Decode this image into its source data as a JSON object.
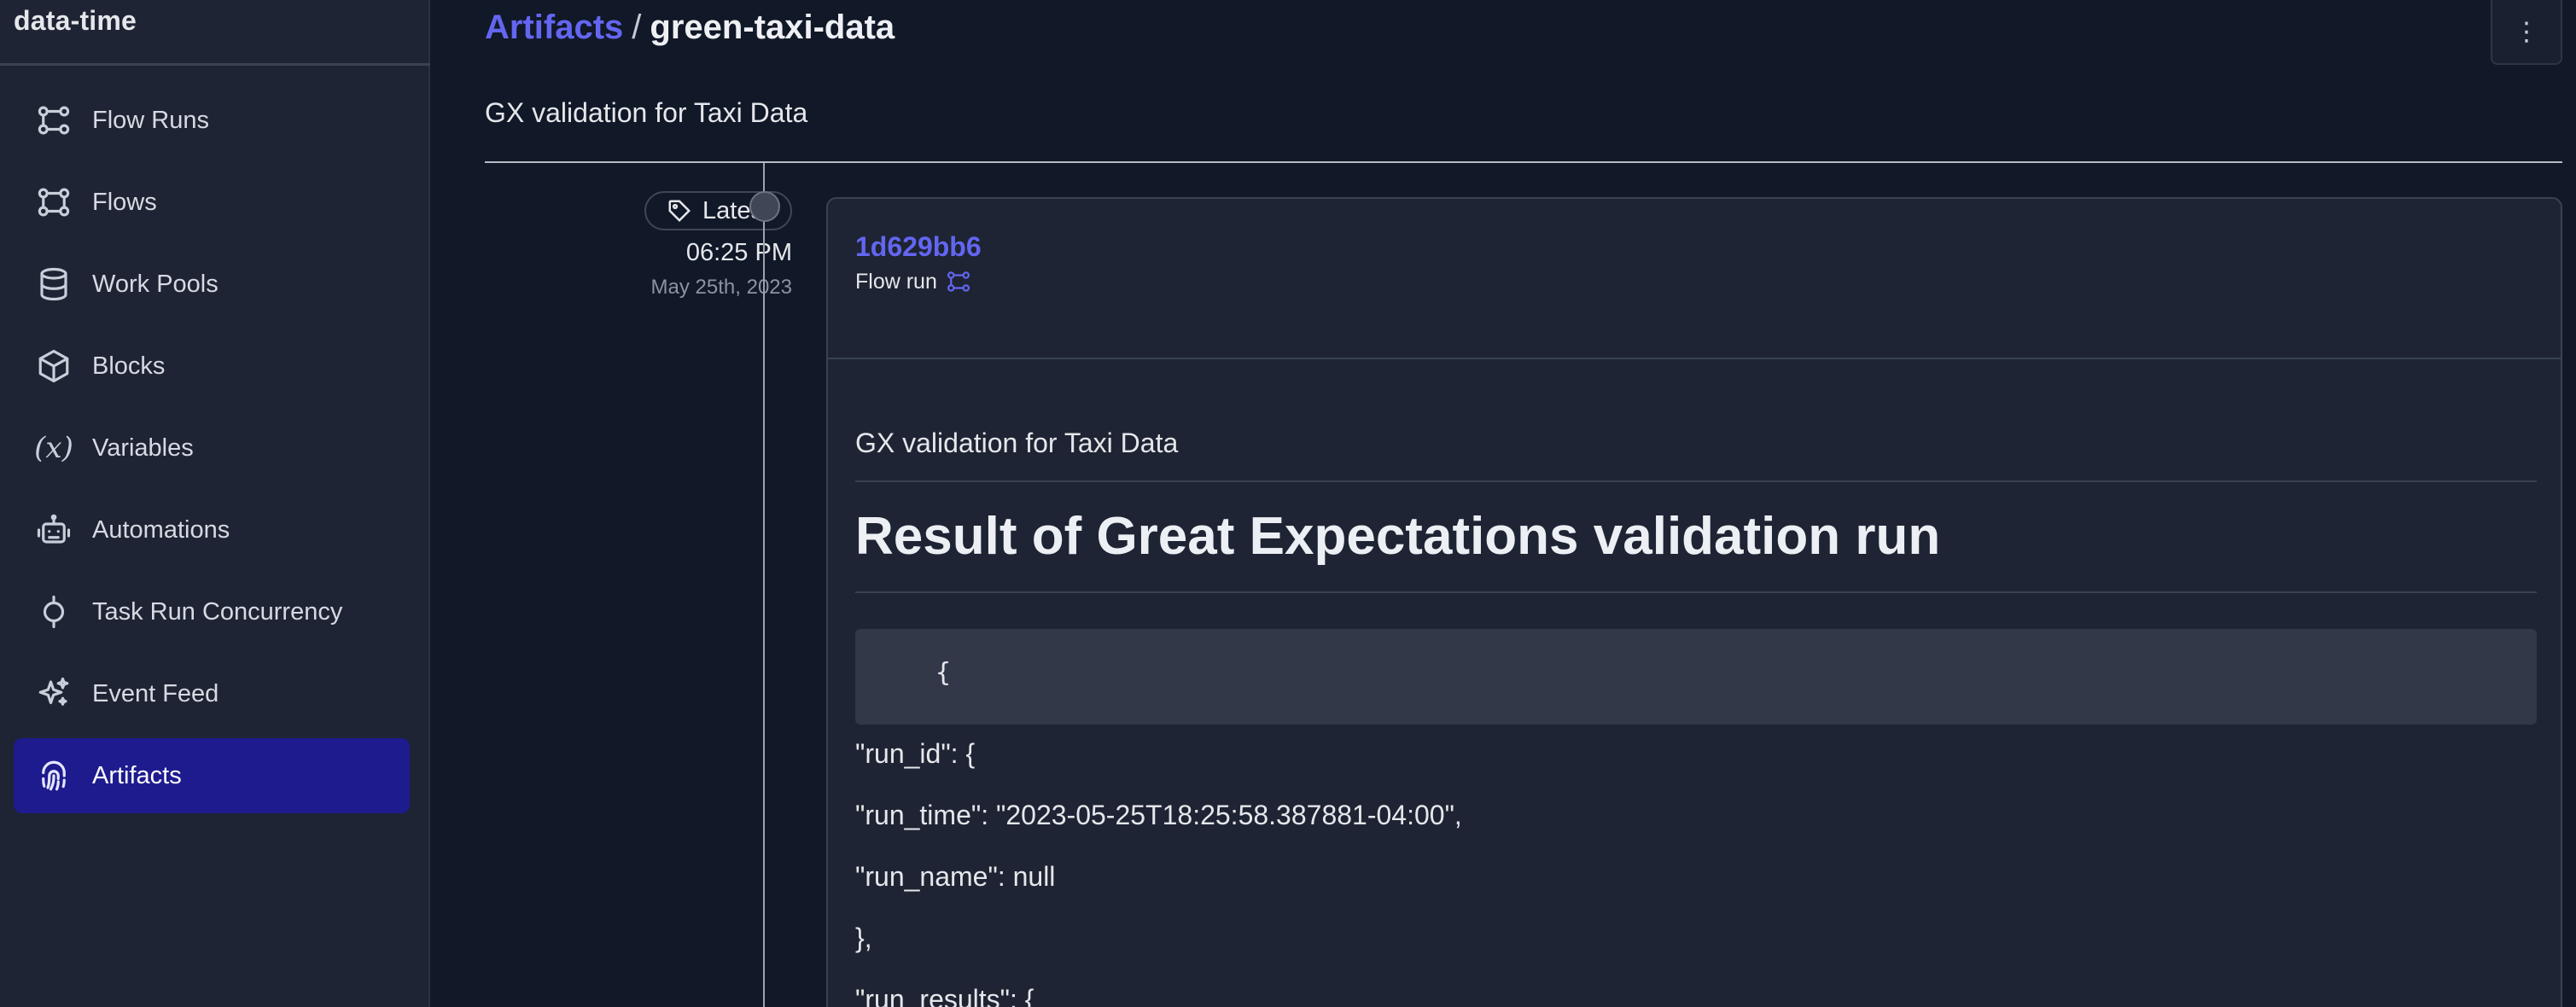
{
  "sidebar": {
    "workspace": "data-time",
    "items": [
      {
        "label": "Flow Runs",
        "icon": "flow-runs-icon"
      },
      {
        "label": "Flows",
        "icon": "flows-icon"
      },
      {
        "label": "Work Pools",
        "icon": "database-icon"
      },
      {
        "label": "Blocks",
        "icon": "cube-icon"
      },
      {
        "label": "Variables",
        "icon": "variable-icon",
        "glyph": "(x)"
      },
      {
        "label": "Automations",
        "icon": "robot-icon"
      },
      {
        "label": "Task Run Concurrency",
        "icon": "concurrency-icon"
      },
      {
        "label": "Event Feed",
        "icon": "sparkles-icon"
      },
      {
        "label": "Artifacts",
        "icon": "fingerprint-icon",
        "active": true
      }
    ]
  },
  "header": {
    "breadcrumb_parent": "Artifacts",
    "breadcrumb_separator": "/",
    "breadcrumb_current": "green-taxi-data",
    "menu_label": "⋮",
    "description": "GX validation for Taxi Data"
  },
  "timeline": {
    "badge": "Latest",
    "time": "06:25 PM",
    "date": "May 25th, 2023"
  },
  "artifact": {
    "run_id": "1d629bb6",
    "run_type": "Flow run",
    "markdown": {
      "intro": "GX validation for Taxi Data",
      "heading": "Result of Great Expectations validation run",
      "code": "{",
      "lines": [
        "\"run_id\": {",
        "\"run_time\": \"2023-05-25T18:25:58.387881-04:00\",",
        "\"run_name\": null",
        "},",
        "\"run_results\": {"
      ]
    }
  },
  "colors": {
    "accent": "#6366f1",
    "active_nav": "#1e1b8f",
    "background": "#111827",
    "sidebar": "#1e2433"
  }
}
